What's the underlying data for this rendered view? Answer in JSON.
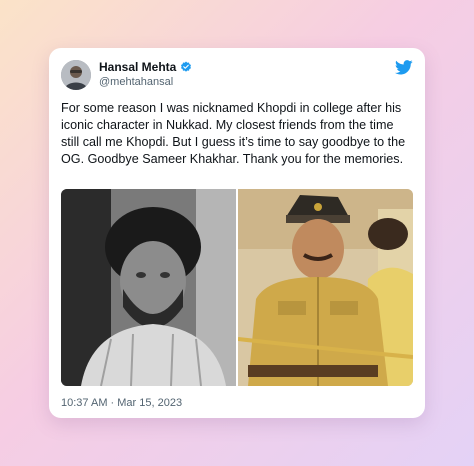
{
  "tweet": {
    "display_name": "Hansal Mehta",
    "handle": "@mehtahansal",
    "verified": true,
    "text": "For some reason I was nicknamed Khopdi in college after his iconic character in Nukkad. My closest friends from the time still call me Khopdi. But I guess it’s time to say goodbye to the OG. Goodbye Sameer Khakhar. Thank you for the memories.",
    "timestamp": "10:37 AM · Mar 15, 2023"
  },
  "icons": {
    "avatar": "avatar-photo",
    "verified": "verified-badge-icon",
    "brand": "twitter-bird-icon"
  },
  "media": [
    {
      "name": "black-and-white-portrait-photo"
    },
    {
      "name": "police-costume-film-still"
    }
  ],
  "colors": {
    "brand": "#1d9bf0",
    "text": "#0f1419",
    "muted": "#536471"
  }
}
